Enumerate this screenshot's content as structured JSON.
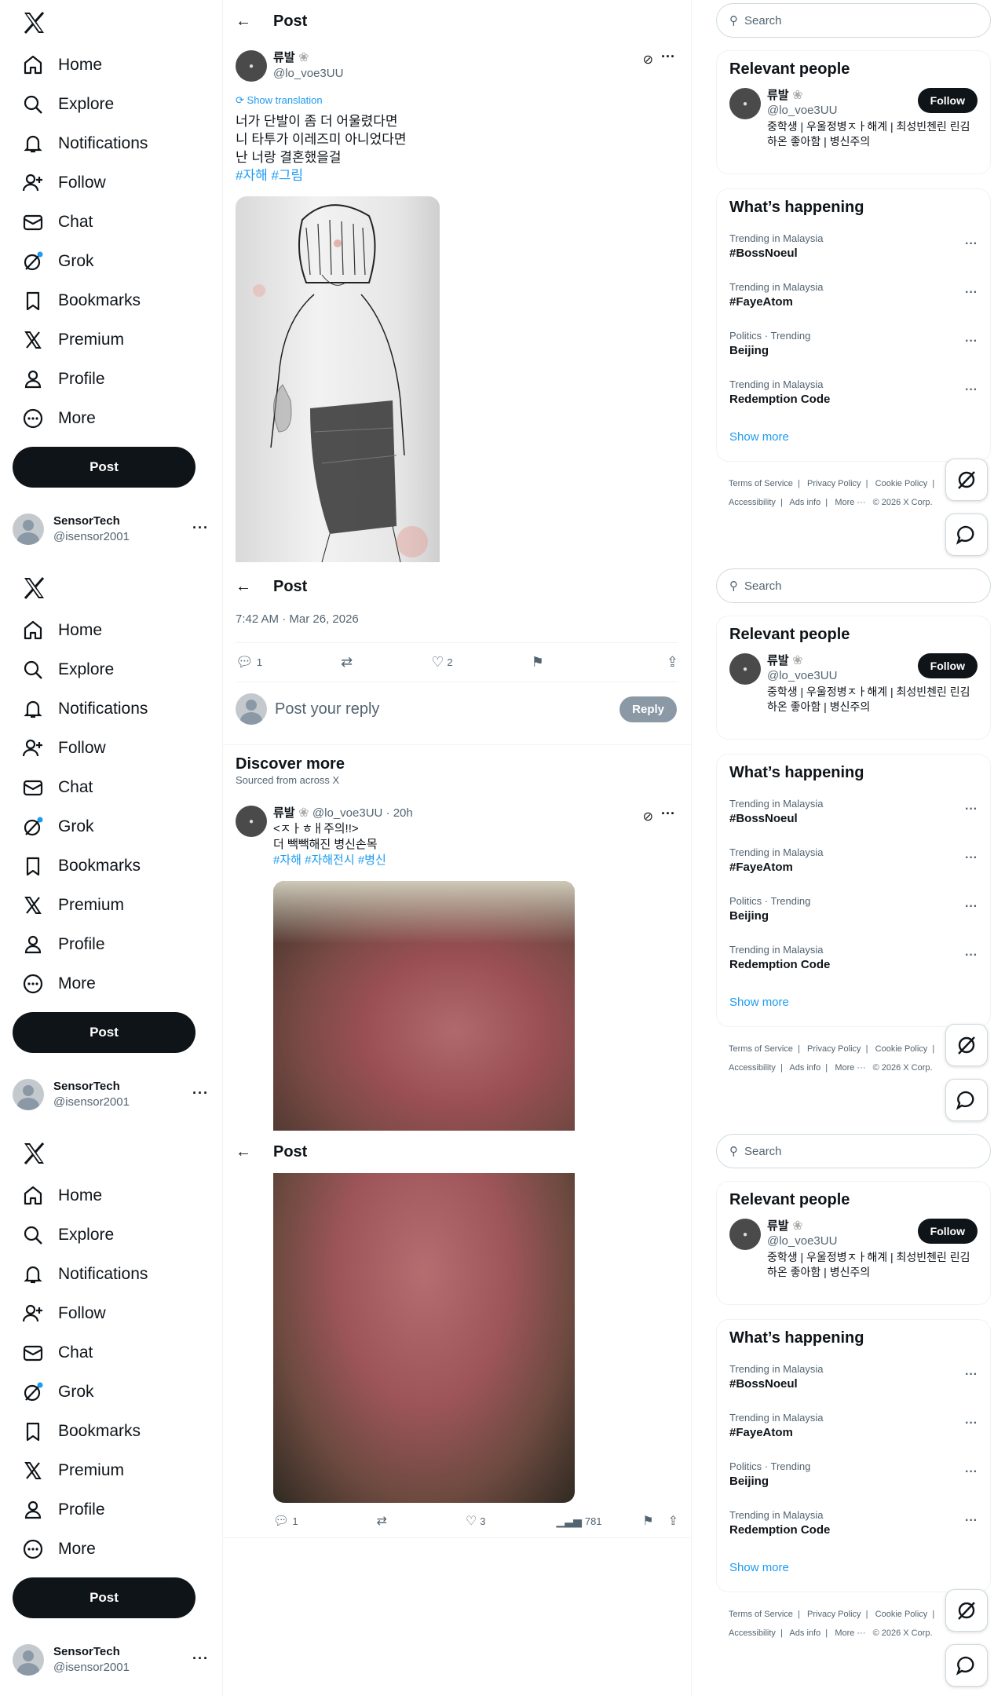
{
  "nav": {
    "items": [
      {
        "label": "Home",
        "icon": "home-icon"
      },
      {
        "label": "Explore",
        "icon": "search-icon"
      },
      {
        "label": "Notifications",
        "icon": "bell-icon"
      },
      {
        "label": "Follow",
        "icon": "person-plus-icon"
      },
      {
        "label": "Chat",
        "icon": "mail-icon"
      },
      {
        "label": "Grok",
        "icon": "grok-icon"
      },
      {
        "label": "Bookmarks",
        "icon": "bookmark-icon"
      },
      {
        "label": "Premium",
        "icon": "x-icon"
      },
      {
        "label": "Profile",
        "icon": "person-icon"
      },
      {
        "label": "More",
        "icon": "more-circle-icon"
      }
    ],
    "post_label": "Post",
    "account": {
      "name": "SensorTech",
      "handle": "@isensor2001"
    }
  },
  "header": {
    "title": "Post"
  },
  "post": {
    "author": "류발",
    "handle": "@lo_voe3UU",
    "show_translation": "Show translation",
    "lines": [
      "너가 단발이 좀 더 어울렸다면",
      "니 타투가 이레즈미 아니었다면",
      "난 너랑 결혼했을걸"
    ],
    "hashtags": "#자해 #그림",
    "timestamp": "7:42 AM · Mar 26, 2026",
    "replies": "1",
    "likes": "2"
  },
  "reply": {
    "placeholder": "Post your reply",
    "button": "Reply"
  },
  "discover": {
    "title": "Discover more",
    "subtitle": "Sourced from across X",
    "post": {
      "author": "류발",
      "handle": "@lo_voe3UU · 20h",
      "lines": [
        "<ㅈㅏㅎㅐ주의!!>",
        "더 빽빽해진 병신손목"
      ],
      "hashtags": "#자해 #자해전시 #병신",
      "replies": "1",
      "likes": "3",
      "views": "781"
    }
  },
  "search": {
    "placeholder": "Search"
  },
  "relevant": {
    "title": "Relevant people",
    "name": "류발",
    "handle": "@lo_voe3UU",
    "follow": "Follow",
    "bio": "중학생 | 우울정병ㅈㅏ해계 | 최성빈첸린 린김하온 좋아함 | 병신주의"
  },
  "happening": {
    "title": "What’s happening",
    "trends": [
      {
        "context": "Trending in Malaysia",
        "name": "#BossNoeul"
      },
      {
        "context": "Trending in Malaysia",
        "name": "#FayeAtom"
      },
      {
        "context": "Politics · Trending",
        "name": "Beijing"
      },
      {
        "context": "Trending in Malaysia",
        "name": "Redemption Code"
      }
    ],
    "show_more": "Show more"
  },
  "footer": {
    "links1": "Terms of Service  |   Privacy Policy  |   Cookie Policy  |",
    "links2": "Accessibility  |   Ads info  |   More ···   © 2026 X Corp."
  }
}
